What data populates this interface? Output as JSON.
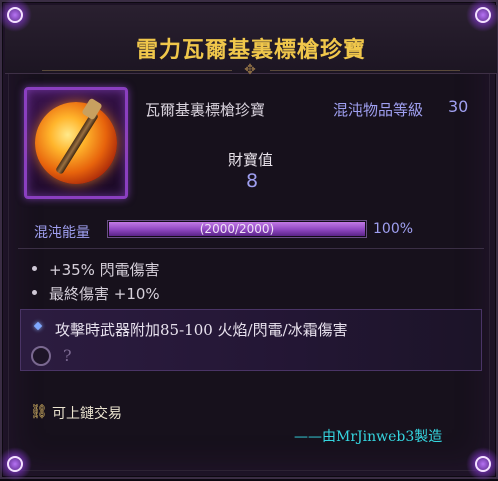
{
  "item": {
    "title": "雷力瓦爾基裏標槍珍寶",
    "name": "瓦爾基裏標槍珍寶",
    "level_label": "混沌物品等級",
    "level_value": "30",
    "treasure_label": "財寶值",
    "treasure_value": "8",
    "icon": "gem-orb-staff-icon"
  },
  "chaos": {
    "label": "混沌能量",
    "bar_text": "(2000/2000)",
    "percent_text": "100%",
    "fill_fraction": 1.0,
    "bar_color": "#9b55cf"
  },
  "stats": [
    "+35% 閃電傷害",
    "最終傷害 +10%"
  ],
  "affix": {
    "text": "攻擊時武器附加85-100 火焰/閃電/冰霜傷害",
    "socket_text": "?"
  },
  "trade": {
    "icon": "chain-icon",
    "text": "可上鏈交易"
  },
  "credit": "——由MrJinweb3製造",
  "colors": {
    "title": "#f0c74b",
    "accent_blue": "#9f9ff0",
    "credit_cyan": "#35d6e0",
    "frame_purple": "#8a3fc0"
  }
}
